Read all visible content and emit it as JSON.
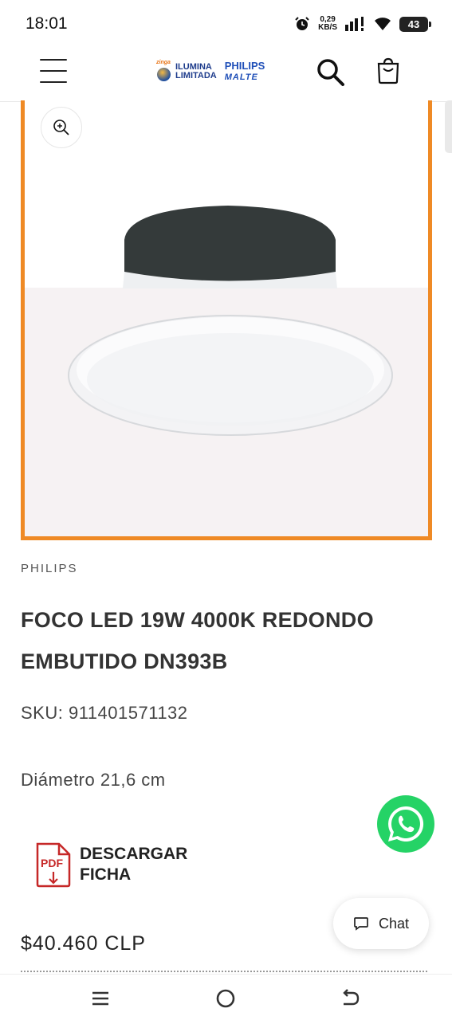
{
  "status_bar": {
    "time": "18:01",
    "net_speed_value": "0,29",
    "net_speed_unit": "KB/S",
    "battery": "43"
  },
  "header": {
    "logo_small": "zinga",
    "logo_line1": "ILUMINA",
    "logo_line2": "LIMITADA",
    "logo_brand": "PHILIPS",
    "logo_sub": "MALTE"
  },
  "product": {
    "brand": "PHILIPS",
    "title": "FOCO LED 19W 4000K REDONDO EMBUTIDO DN393B",
    "sku": "SKU: 911401571132",
    "diameter": "Diámetro 21,6 cm",
    "download_label": "DESCARGAR FICHA",
    "download_icon_text": "PDF",
    "price": "$40.460 CLP"
  },
  "floating": {
    "chat_label": "Chat"
  },
  "colors": {
    "image_border": "#ef8a25",
    "whatsapp": "#25d366",
    "pdf_red": "#c62828"
  }
}
